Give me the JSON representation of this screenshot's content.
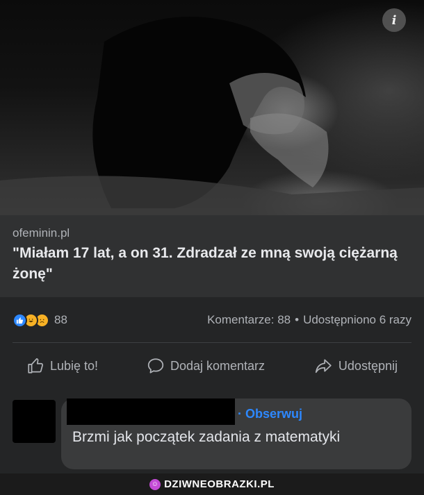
{
  "post": {
    "info_icon": "info-icon",
    "source": "ofeminin.pl",
    "headline": "\"Miałam 17 lat, a on 31. Zdradzał ze mną swoją ciężarną żonę\""
  },
  "stats": {
    "reaction_icons": [
      "like-reaction-icon",
      "haha-reaction-icon",
      "sad-reaction-icon"
    ],
    "reaction_count": "88",
    "comments": "Komentarze: 88",
    "separator": "•",
    "shares": "Udostępniono 6 razy"
  },
  "actions": {
    "like_label": "Lubię to!",
    "comment_label": "Dodaj komentarz",
    "share_label": "Udostępnij"
  },
  "comment": {
    "separator": "·",
    "follow_label": "Obserwuj",
    "text": "Brzmi jak początek zadania z matematyki"
  },
  "watermark": {
    "text": "DZIWNEOBRAZKI.PL"
  },
  "colors": {
    "background": "#242526",
    "link_block": "#303132",
    "accent": "#2d88ff",
    "watermark_dot": "#c44bd6"
  }
}
